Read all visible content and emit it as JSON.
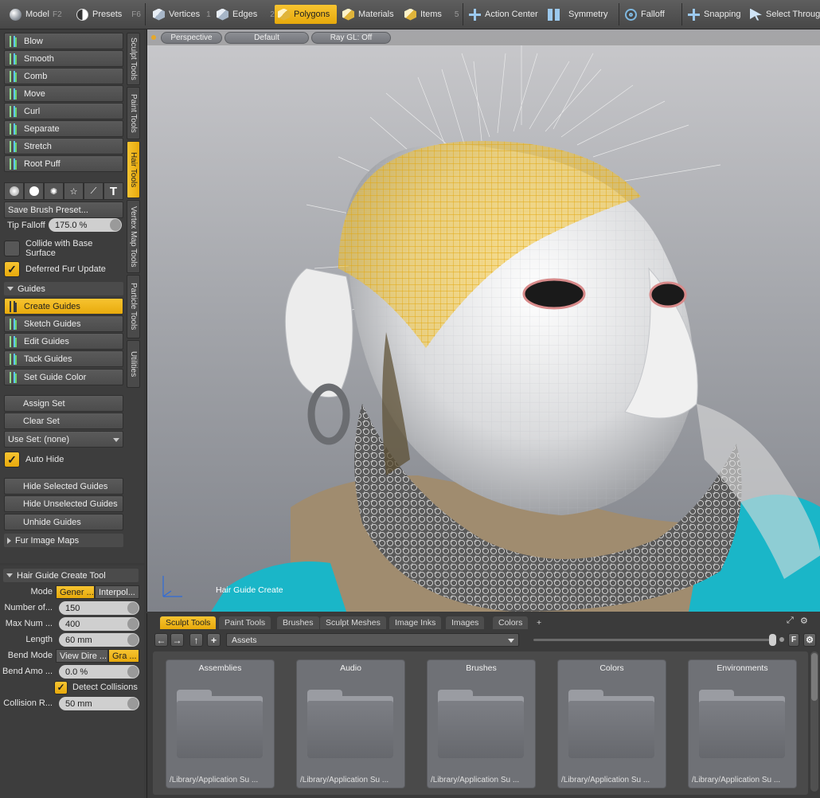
{
  "topbar": {
    "model": "Model",
    "model_key": "F2",
    "presets": "Presets",
    "presets_key": "F6",
    "vertices": "Vertices",
    "vertices_key": "1",
    "edges": "Edges",
    "edges_key": "2",
    "polygons": "Polygons",
    "materials": "Materials",
    "items": "Items",
    "items_key": "5",
    "action_center": "Action Center",
    "symmetry": "Symmetry",
    "falloff": "Falloff",
    "snapping": "Snapping",
    "select_through": "Select Through"
  },
  "tools": {
    "blow": "Blow",
    "smooth": "Smooth",
    "comb": "Comb",
    "move": "Move",
    "curl": "Curl",
    "separate": "Separate",
    "stretch": "Stretch",
    "root_puff": "Root Puff",
    "save_brush_preset": "Save Brush Preset...",
    "tip_falloff_label": "Tip Falloff",
    "tip_falloff_value": "175.0 %",
    "collide": "Collide with Base Surface",
    "deferred": "Deferred Fur Update",
    "guides_section": "Guides",
    "create_guides": "Create Guides",
    "sketch_guides": "Sketch Guides",
    "edit_guides": "Edit Guides",
    "tack_guides": "Tack Guides",
    "set_guide_color": "Set Guide Color",
    "assign_set": "Assign Set",
    "clear_set": "Clear Set",
    "use_set": "Use Set: (none)",
    "auto_hide": "Auto Hide",
    "hide_selected": "Hide Selected Guides",
    "hide_unselected": "Hide Unselected Guides",
    "unhide": "Unhide Guides",
    "fur_image_maps": "Fur Image Maps"
  },
  "vtabs": {
    "sculpt": "Sculpt Tools",
    "paint": "Paint Tools",
    "hair": "Hair Tools",
    "vertex_map": "Vertex Map Tools",
    "particle": "Particle Tools",
    "utilities": "Utilities"
  },
  "props": {
    "header": "Hair Guide Create Tool",
    "mode_label": "Mode",
    "mode_a": "Gener ...",
    "mode_b": "Interpol...",
    "number_label": "Number of...",
    "number_value": "150",
    "maxnum_label": "Max Num ...",
    "maxnum_value": "400",
    "length_label": "Length",
    "length_value": "60 mm",
    "bendmode_label": "Bend Mode",
    "bendmode_a": "View Dire ...",
    "bendmode_b": "Gra ...",
    "bendamo_label": "Bend Amo ...",
    "bendamo_value": "0.0 %",
    "detect": "Detect Collisions",
    "collision_label": "Collision R...",
    "collision_value": "50 mm"
  },
  "viewport": {
    "perspective": "Perspective",
    "default": "Default",
    "raygl": "Ray GL: Off",
    "label": "Hair Guide Create"
  },
  "browser": {
    "tabs": [
      "Sculpt Tools",
      "Paint Tools",
      "Brushes",
      "Sculpt Meshes",
      "Image Inks",
      "Images",
      "Colors"
    ],
    "plus": "+",
    "assets": "Assets",
    "f_label": "F",
    "cards": [
      {
        "title": "Assemblies",
        "path": "/Library/Application Su ..."
      },
      {
        "title": "Audio",
        "path": "/Library/Application Su ..."
      },
      {
        "title": "Brushes",
        "path": "/Library/Application Su ..."
      },
      {
        "title": "Colors",
        "path": "/Library/Application Su ..."
      },
      {
        "title": "Environments",
        "path": "/Library/Application Su ..."
      }
    ]
  },
  "colors": {
    "accent": "#f0b81e",
    "wire": "#f3c12e",
    "teal": "#1ab6c8"
  }
}
